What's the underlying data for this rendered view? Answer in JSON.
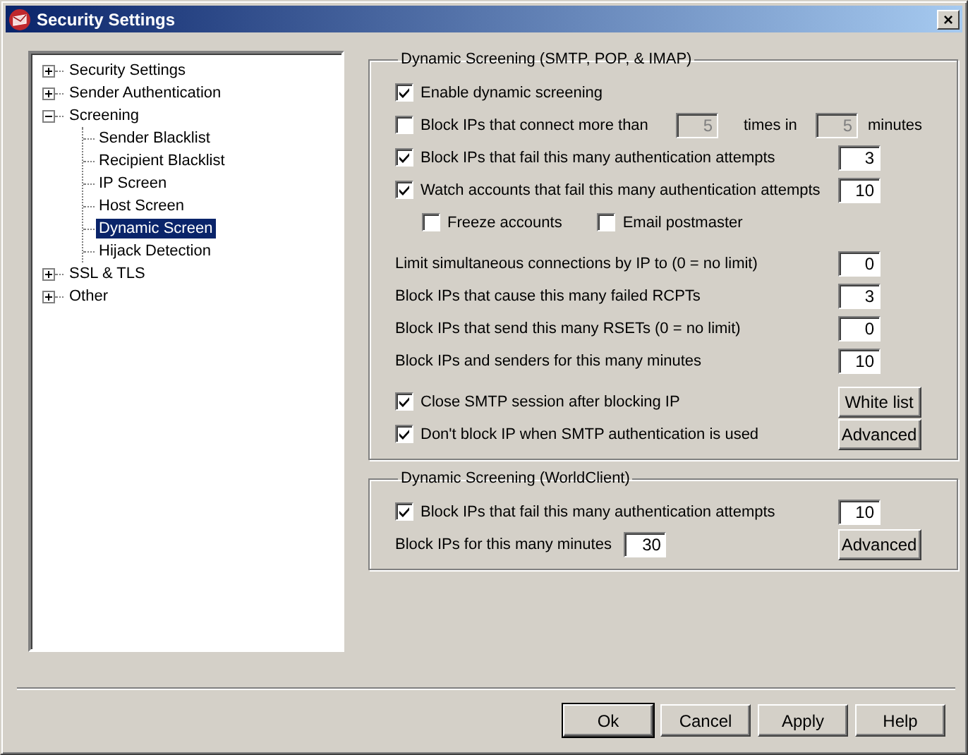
{
  "window": {
    "title": "Security Settings",
    "close": "×"
  },
  "tree": [
    {
      "label": "Security Settings",
      "expanded": false,
      "selected": false
    },
    {
      "label": "Sender Authentication",
      "expanded": false,
      "selected": false
    },
    {
      "label": "Screening",
      "expanded": true,
      "selected": false,
      "children": [
        {
          "label": "Sender Blacklist",
          "selected": false
        },
        {
          "label": "Recipient Blacklist",
          "selected": false
        },
        {
          "label": "IP Screen",
          "selected": false
        },
        {
          "label": "Host Screen",
          "selected": false
        },
        {
          "label": "Dynamic Screen",
          "selected": true
        },
        {
          "label": "Hijack Detection",
          "selected": false
        }
      ]
    },
    {
      "label": "SSL & TLS",
      "expanded": false,
      "selected": false
    },
    {
      "label": "Other",
      "expanded": false,
      "selected": false
    }
  ],
  "groups": [
    {
      "title": "Dynamic Screening (SMTP, POP, & IMAP)",
      "rows": [
        {
          "kind": "check",
          "label": "Enable dynamic screening",
          "checked": true
        },
        {
          "kind": "range",
          "label": "Block IPs that connect more than",
          "checked": false,
          "value": "5",
          "mid_label": "times in",
          "value2": "5",
          "end_label": "minutes",
          "disabled": true
        },
        {
          "kind": "check",
          "label": "Block IPs that fail this many authentication attempts",
          "checked": true,
          "value": "3"
        },
        {
          "kind": "check",
          "label": "Watch accounts that fail this many authentication attempts",
          "checked": true,
          "value": "10"
        },
        {
          "kind": "subchecks",
          "items": [
            {
              "label": "Freeze accounts",
              "checked": false
            },
            {
              "label": "Email postmaster",
              "checked": false
            }
          ]
        },
        {
          "kind": "number",
          "label": "Limit simultaneous connections by IP to (0 = no limit)",
          "value": "0"
        },
        {
          "kind": "number",
          "label": "Block IPs that cause this many failed RCPTs",
          "value": "3"
        },
        {
          "kind": "number",
          "label": "Block IPs that send this many RSETs (0 = no limit)",
          "value": "0"
        },
        {
          "kind": "number",
          "label": "Block IPs and senders for this many minutes",
          "value": "10"
        },
        {
          "kind": "check",
          "label": "Close SMTP session after blocking IP",
          "checked": true,
          "button": "White list"
        },
        {
          "kind": "check",
          "label": "Don't block IP when SMTP authentication is used",
          "checked": true,
          "button": "Advanced"
        }
      ]
    },
    {
      "title": "Dynamic Screening (WorldClient)",
      "rows": [
        {
          "kind": "check",
          "label": "Block IPs that fail this many authentication attempts",
          "checked": true,
          "value": "10"
        },
        {
          "kind": "inline",
          "label": "Block IPs for this many minutes",
          "value": "30",
          "button": "Advanced"
        }
      ]
    }
  ],
  "buttons": [
    {
      "label": "Ok",
      "default": true
    },
    {
      "label": "Cancel",
      "default": false
    },
    {
      "label": "Apply",
      "default": false
    },
    {
      "label": "Help",
      "default": false
    }
  ]
}
